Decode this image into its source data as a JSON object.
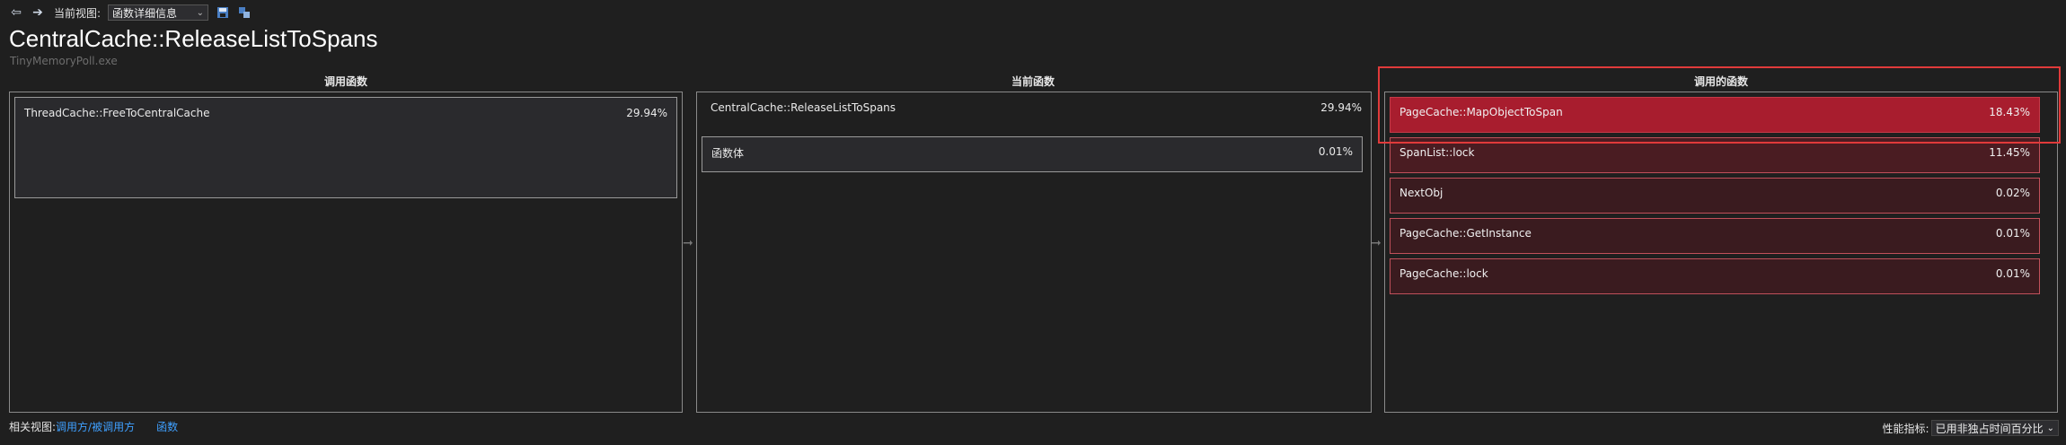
{
  "toolbar": {
    "back_icon": "back-arrow-icon",
    "forward_icon": "forward-arrow-icon",
    "view_label": "当前视图:",
    "view_select": "函数详细信息",
    "save_icon": "save-icon",
    "share_icon": "share-icon"
  },
  "header": {
    "title": "CentralCache::ReleaseListToSpans",
    "subtitle": "TinyMemoryPoll.exe"
  },
  "columns": {
    "callers_title": "调用函数",
    "current_title": "当前函数",
    "callees_title": "调用的函数"
  },
  "callers": [
    {
      "name": "ThreadCache::FreeToCentralCache",
      "pct": "29.94%"
    }
  ],
  "current": {
    "name": "CentralCache::ReleaseListToSpans",
    "pct": "29.94%",
    "body_name": "函数体",
    "body_pct": "0.01%"
  },
  "callees": [
    {
      "name": "PageCache::MapObjectToSpan",
      "pct": "18.43%"
    },
    {
      "name": "SpanList::lock",
      "pct": "11.45%"
    },
    {
      "name": "NextObj",
      "pct": "0.02%"
    },
    {
      "name": "PageCache::GetInstance",
      "pct": "0.01%"
    },
    {
      "name": "PageCache::lock",
      "pct": "0.01%"
    }
  ],
  "footer": {
    "related_label": "相关视图:",
    "link_callers": "调用方/被调用方",
    "link_functions": "函数",
    "metric_label": "性能指标:",
    "metric_value": "已用非独占时间百分比"
  },
  "colors": {
    "callee_1": "#a81d2e",
    "callee_2": "#4a1c22",
    "callee_other": "#3a1b1f",
    "callee_border": "#c0505a",
    "highlight": "#e03a3a",
    "link": "#3fa0ff"
  }
}
